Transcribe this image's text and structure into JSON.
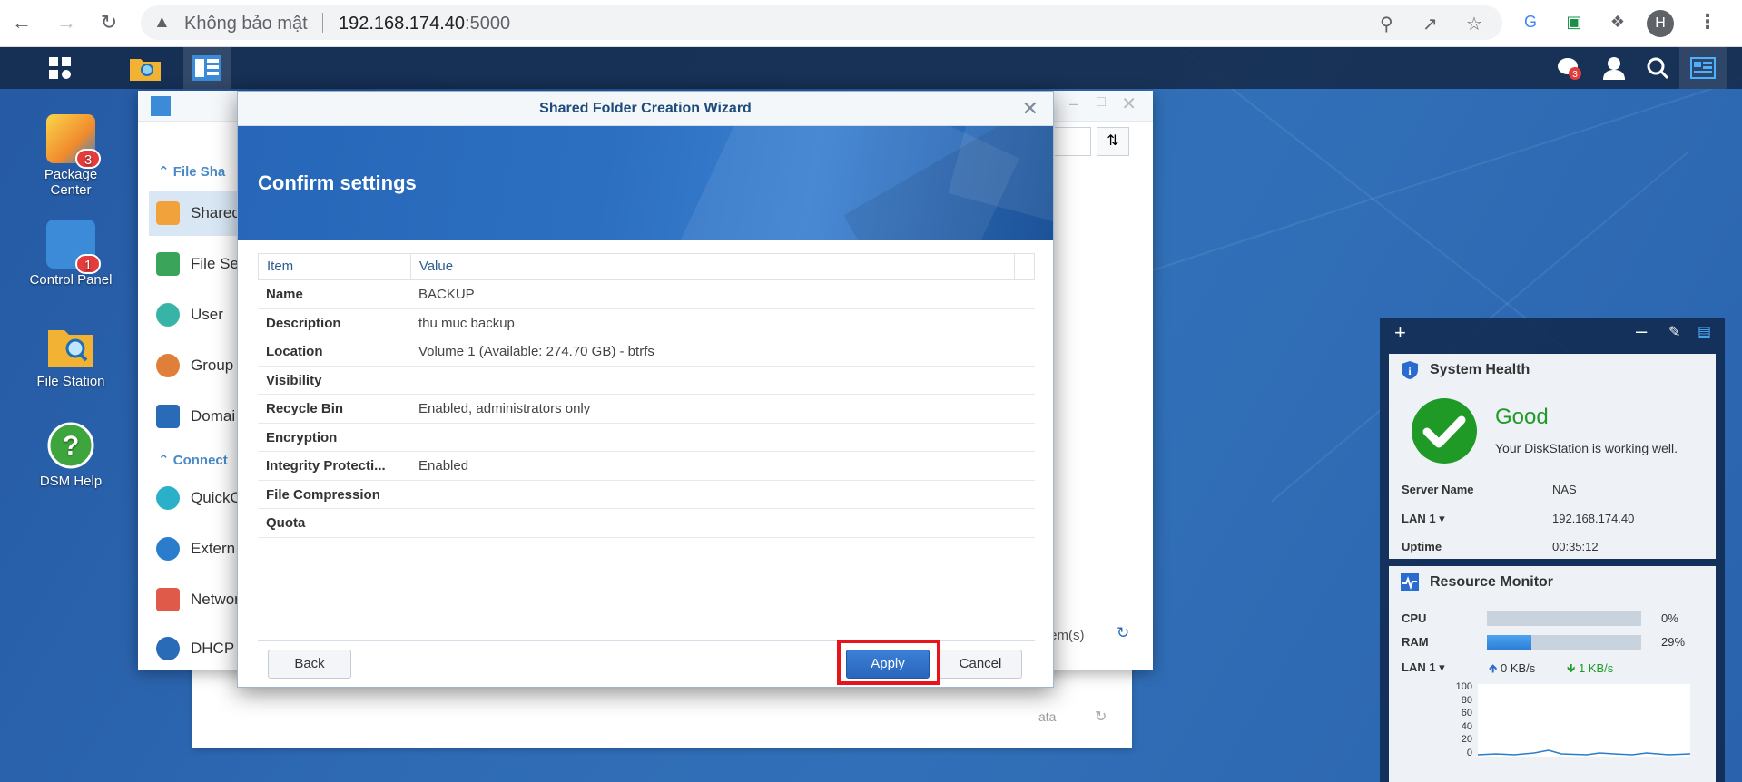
{
  "browser": {
    "security_label": "Không bảo mật",
    "url_host": "192.168.174.40",
    "url_port": ":5000",
    "profile_initial": "H"
  },
  "desktop": {
    "icons": [
      {
        "label": "Package\nCenter",
        "badge": "3"
      },
      {
        "label": "Control Panel",
        "badge": "1"
      },
      {
        "label": "File Station",
        "badge": ""
      },
      {
        "label": "DSM Help",
        "badge": ""
      }
    ],
    "notification_count": "3"
  },
  "control_panel": {
    "search_placeholder": "S",
    "category_file_sharing": "File Sha",
    "items": [
      "Sharec",
      "File Se",
      "User",
      "Group",
      "Domai"
    ],
    "category_connectivity": "Connect",
    "items2": [
      "QuickC",
      "Extern",
      "Networ",
      "DHCP S"
    ],
    "status_items": "tem(s)",
    "status_data": "ata"
  },
  "wizard": {
    "title": "Shared Folder Creation Wizard",
    "step_title": "Confirm settings",
    "columns": [
      "Item",
      "Value"
    ],
    "rows": [
      {
        "item": "Name",
        "value": "BACKUP"
      },
      {
        "item": "Description",
        "value": "thu muc backup"
      },
      {
        "item": "Location",
        "value": "Volume 1 (Available: 274.70 GB) - btrfs"
      },
      {
        "item": "Visibility",
        "value": ""
      },
      {
        "item": "Recycle Bin",
        "value": "Enabled, administrators only"
      },
      {
        "item": "Encryption",
        "value": ""
      },
      {
        "item": "Integrity Protecti...",
        "value": "Enabled"
      },
      {
        "item": "File Compression",
        "value": ""
      },
      {
        "item": "Quota",
        "value": ""
      }
    ],
    "back_label": "Back",
    "apply_label": "Apply",
    "cancel_label": "Cancel"
  },
  "widgets": {
    "system_health": {
      "title": "System Health",
      "status": "Good",
      "message": "Your DiskStation is working well.",
      "server_name_label": "Server Name",
      "server_name": "NAS",
      "lan_label": "LAN 1",
      "lan_ip": "192.168.174.40",
      "uptime_label": "Uptime",
      "uptime": "00:35:12"
    },
    "resource_monitor": {
      "title": "Resource Monitor",
      "cpu_label": "CPU",
      "cpu_value": "0%",
      "cpu_fraction": 0.0,
      "ram_label": "RAM",
      "ram_value": "29%",
      "ram_fraction": 0.29,
      "lan_label": "LAN 1",
      "upload": "0 KB/s",
      "download": "1 KB/s",
      "chart_ticks": [
        "100",
        "80",
        "60",
        "40",
        "20",
        "0"
      ]
    }
  },
  "colors": {
    "accent": "#2a66bd",
    "highlight": "#e8141c",
    "good": "#1f9a26"
  }
}
